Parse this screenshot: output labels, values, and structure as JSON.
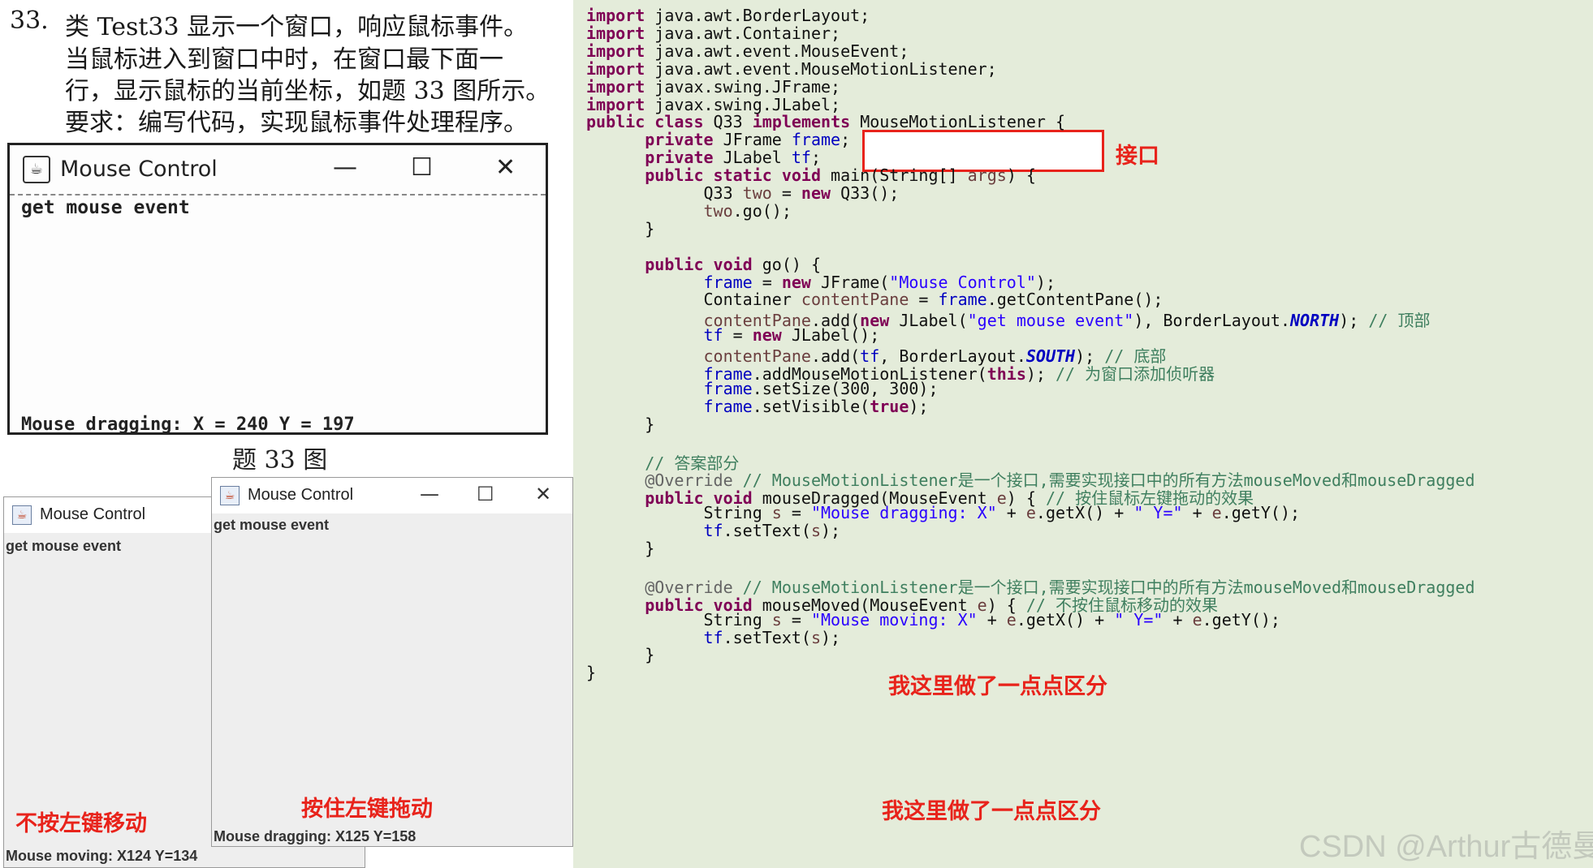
{
  "question": {
    "number": "33.",
    "lines": [
      "类 Test33 显示一个窗口，响应鼠标事件。",
      "当鼠标进入到窗口中时，在窗口最下面一",
      "行，显示鼠标的当前坐标，如题 33 图所示。",
      "要求：编写代码，实现鼠标事件处理程序。"
    ],
    "figure_caption": "题 33 图"
  },
  "book_window": {
    "title": "Mouse Control",
    "top_label": "get mouse event",
    "bottom_label": "Mouse dragging:  X = 240  Y = 197",
    "controls": {
      "minimize": "—",
      "maximize": "☐",
      "close": "✕"
    }
  },
  "swing_moving": {
    "title": "Mouse Control",
    "top_label": "get mouse event",
    "bottom_label": "Mouse moving: X124 Y=134",
    "note": "不按左键移动"
  },
  "swing_dragging": {
    "title": "Mouse Control",
    "top_label": "get mouse event",
    "bottom_label": "Mouse dragging: X125 Y=158",
    "note": "按住左键拖动",
    "controls": {
      "minimize": "—",
      "maximize": "☐",
      "close": "✕"
    }
  },
  "code": {
    "lines": [
      "import java.awt.BorderLayout;",
      "import java.awt.Container;",
      "import java.awt.event.MouseEvent;",
      "import java.awt.event.MouseMotionListener;",
      "import javax.swing.JFrame;",
      "import javax.swing.JLabel;",
      "public class Q33 implements MouseMotionListener {",
      "      private JFrame frame;",
      "      private JLabel tf;",
      "      public static void main(String[] args) {",
      "            Q33 two = new Q33();",
      "            two.go();",
      "      }",
      "",
      "      public void go() {",
      "            frame = new JFrame(\"Mouse Control\");",
      "            Container contentPane = frame.getContentPane();",
      "            contentPane.add(new JLabel(\"get mouse event\"), BorderLayout.NORTH); // 顶部",
      "            tf = new JLabel();",
      "            contentPane.add(tf, BorderLayout.SOUTH); // 底部",
      "            frame.addMouseMotionListener(this); // 为窗口添加侦听器",
      "            frame.setSize(300, 300);",
      "            frame.setVisible(true);",
      "      }",
      "",
      "      // 答案部分",
      "      @Override // MouseMotionListener是一个接口,需要实现接口中的所有方法mouseMoved和mouseDragged",
      "      public void mouseDragged(MouseEvent e) { // 按住鼠标左键拖动的效果",
      "            String s = \"Mouse dragging: X\" + e.getX() + \" Y=\" + e.getY();",
      "            tf.setText(s);",
      "      }",
      "",
      "      @Override // MouseMotionListener是一个接口,需要实现接口中的所有方法mouseMoved和mouseDragged",
      "      public void mouseMoved(MouseEvent e) { // 不按住鼠标移动的效果",
      "            String s = \"Mouse moving: X\" + e.getX() + \" Y=\" + e.getY();",
      "            tf.setText(s);",
      "      }",
      "}"
    ],
    "interface_label": "接口",
    "diff_note_1": "我这里做了一点点区分",
    "diff_note_2": "我这里做了一点点区分"
  },
  "watermark": "CSDN @Arthur古德曼",
  "colors": {
    "code_background": "#e4ecda",
    "keyword": "#7f0055",
    "string": "#2a00ff",
    "comment": "#3f7f5f",
    "field": "#0000c0",
    "highlight_red": "#e8231b"
  }
}
